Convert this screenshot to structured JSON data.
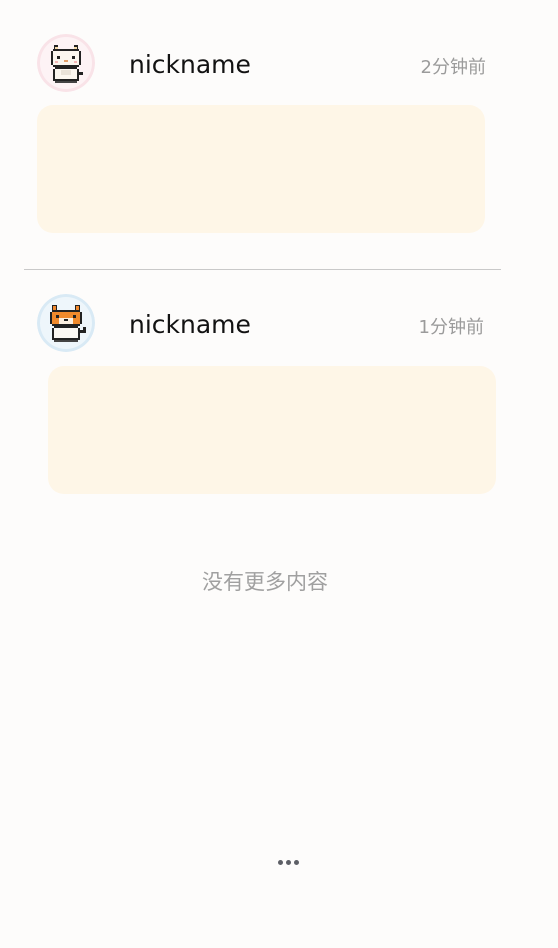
{
  "feed": {
    "posts": [
      {
        "nickname": "nickname",
        "time": "2分钟前",
        "avatar_icon": "pixel-cat-avatar",
        "avatar_ring": "#f7dde3"
      },
      {
        "nickname": "nickname",
        "time": "1分钟前",
        "avatar_icon": "pixel-fox-avatar",
        "avatar_ring": "#d8e9f4"
      }
    ],
    "end_message": "没有更多内容"
  },
  "footer": {
    "more_icon": "more-dots-icon"
  },
  "colors": {
    "background": "#fdfcfb",
    "content_card": "#fef6e7",
    "divider": "#c9c9c9",
    "muted_text": "#9b9b9b"
  }
}
